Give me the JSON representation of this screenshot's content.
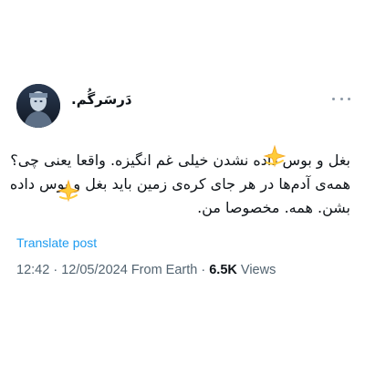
{
  "author": {
    "display_name": "دَرسَرگُم."
  },
  "tweet": {
    "lines": [
      "بغل و بوس داده نشدن خیلی غم انگیزه. واقعا یعنی چی؟",
      "همه‌ی آدم‌ها در هر جای کره‌ی زمین باید بغل و بوس داده",
      "بشن. همه. مخصوصا من."
    ],
    "sparkle_emoji": "dizzy-sparkle-icon"
  },
  "translate_label": "Translate post",
  "meta": {
    "time": "12:42",
    "date": "12/05/2024",
    "source": "From Earth",
    "views_count": "6.5K",
    "views_label": "Views",
    "separator": "·"
  },
  "colors": {
    "link": "#1d9bf0",
    "secondary_text": "#536471",
    "primary_text": "#0f1419"
  }
}
